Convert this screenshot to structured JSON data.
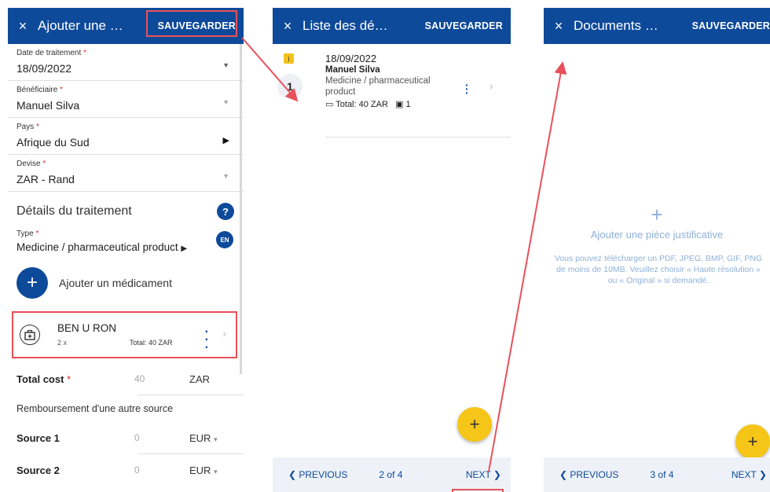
{
  "screen1": {
    "close": "×",
    "title": "Ajouter une …",
    "save": "SAUVEGARDER",
    "fields": [
      {
        "label": "Date de traitement",
        "value": "18/09/2022"
      },
      {
        "label": "Bénéficiaire",
        "value": "Manuel Silva"
      },
      {
        "label": "Pays",
        "value": "Afrique du Sud"
      },
      {
        "label": "Devise",
        "value": "ZAR - Rand"
      }
    ],
    "required_mark": "*",
    "section_title": "Détails du traitement",
    "help": "?",
    "type_label": "Type",
    "type_value": "Medicine / pharmaceutical product",
    "lang_badge": "EN",
    "add_med": "Ajouter un médicament",
    "med": {
      "name": "BEN U RON",
      "qty": "2 x",
      "total": "Total: 40 ZAR"
    },
    "total_cost_label": "Total cost",
    "total_cost_value": "40",
    "total_cost_currency": "ZAR",
    "reimb_label": "Remboursement d'une autre source",
    "sources": [
      {
        "label": "Source 1",
        "value": "0",
        "currency": "EUR"
      },
      {
        "label": "Source 2",
        "value": "0",
        "currency": "EUR"
      }
    ]
  },
  "screen2": {
    "close": "×",
    "title": "Liste des dé…",
    "save": "SAUVEGARDER",
    "item": {
      "badge": "i",
      "number": "1",
      "date": "18/09/2022",
      "name": "Manuel Silva",
      "category_1": "Medicine / pharmaceutical",
      "category_2": "product",
      "total": "Total: 40 ZAR",
      "count": "1"
    },
    "fab": "+",
    "prev": "❮ PREVIOUS",
    "page": "2 of 4",
    "next": "NEXT ❯"
  },
  "screen3": {
    "close": "×",
    "title": "Documents …",
    "save": "SAUVEGARDER",
    "empty_plus": "+",
    "empty_title": "Ajouter une pièce justificative",
    "empty_desc": "Vous pouvez télécharger un PDF, JPEG, BMP, GIF, PNG de moins de 10MB. Veuillez choisir « Haute résolution » ou « Original » si demandé.",
    "fab": "+",
    "prev": "❮ PREVIOUS",
    "page": "3 of 4",
    "next": "NEXT ❯"
  },
  "colors": {
    "primary": "#0e4a9a",
    "accent": "#f5c518",
    "highlight": "#e8515a"
  }
}
